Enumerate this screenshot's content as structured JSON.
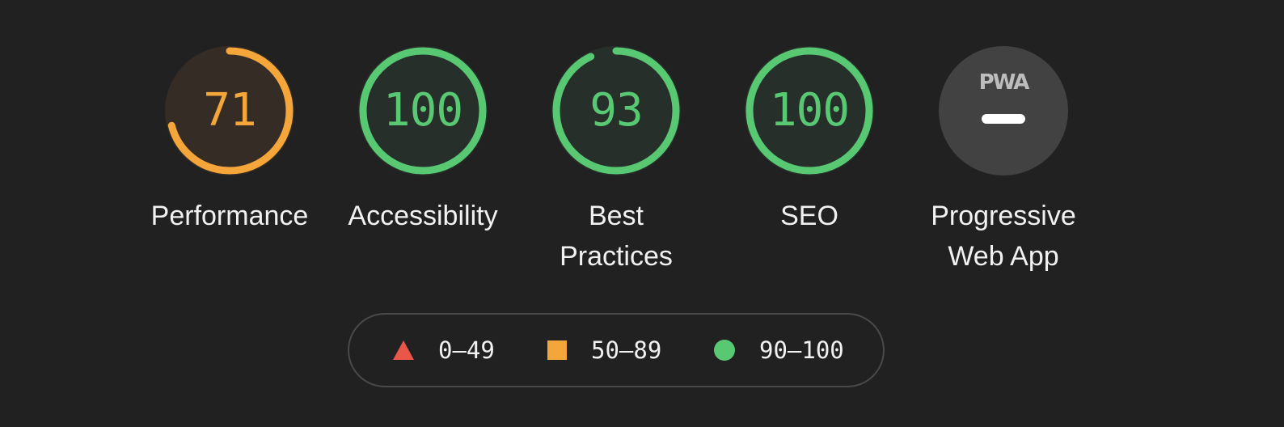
{
  "colors": {
    "background": "#212121",
    "fail": "#e9574a",
    "average": "#f4a63a",
    "pass": "#58c873",
    "average_fill": "#342c25",
    "pass_fill": "#262f29",
    "neutral_fill": "#424242",
    "pwa_logo": "#bdbdbd"
  },
  "gauges": [
    {
      "id": "performance",
      "score": "71",
      "value": 71,
      "rating": "average",
      "label": "Performance"
    },
    {
      "id": "accessibility",
      "score": "100",
      "value": 100,
      "rating": "pass",
      "label": "Accessibility"
    },
    {
      "id": "best-practices",
      "score": "93",
      "value": 93,
      "rating": "pass",
      "label": "Best\nPractices"
    },
    {
      "id": "seo",
      "score": "100",
      "value": 100,
      "rating": "pass",
      "label": "SEO"
    }
  ],
  "pwa": {
    "label": "Progressive\nWeb App",
    "logo_text": "PWA",
    "logo_icon": "pwa-logo-icon",
    "status_icon": "dash-icon"
  },
  "legend": {
    "items": [
      {
        "shape": "triangle-icon",
        "rating": "fail",
        "range": "0–49"
      },
      {
        "shape": "square-icon",
        "rating": "average",
        "range": "50–89"
      },
      {
        "shape": "circle-icon",
        "rating": "pass",
        "range": "90–100"
      }
    ]
  }
}
